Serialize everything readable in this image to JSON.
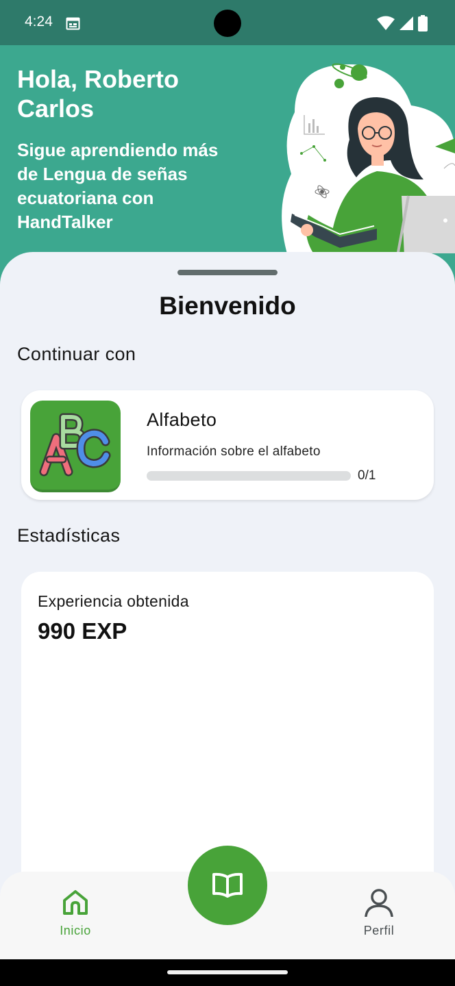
{
  "status_bar": {
    "time": "4:24",
    "icons": [
      "calendar-icon",
      "wifi-icon",
      "signal-icon",
      "battery-icon"
    ]
  },
  "hero": {
    "greeting": "Hola, Roberto Carlos",
    "subtitle": "Sigue aprendiendo más de Lengua de señas ecuatoriana con HandTalker",
    "illustration": "woman-reading-illustration"
  },
  "main": {
    "title": "Bienvenido",
    "continue_section": {
      "title": "Continuar con",
      "lesson": {
        "icon": "abc-blocks-icon",
        "title": "Alfabeto",
        "description": "Información sobre el alfabeto",
        "progress_text": "0/1",
        "progress_fraction": 0
      }
    },
    "stats_section": {
      "title": "Estadísticas",
      "experience_label": "Experiencia obtenida",
      "experience_value": "990 EXP"
    }
  },
  "bottom_nav": {
    "items": [
      {
        "label": "Inicio",
        "icon": "home-icon",
        "active": true
      },
      {
        "label": "Perfil",
        "icon": "user-icon",
        "active": false
      }
    ],
    "fab_icon": "open-book-icon"
  },
  "colors": {
    "brand_green": "#48a339",
    "header_teal": "#3ca88f",
    "status_bar": "#2e7a6a",
    "sheet_background": "#eff2f8"
  }
}
